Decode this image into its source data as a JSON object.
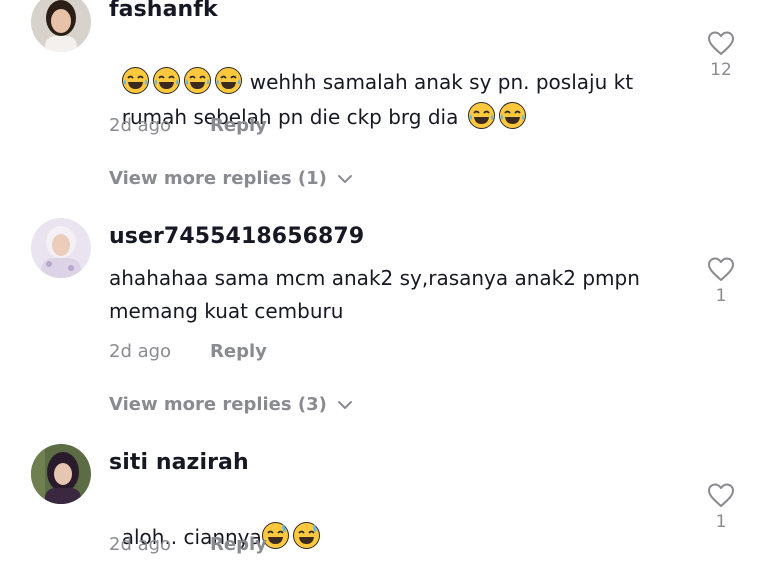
{
  "comments": [
    {
      "username": "fashanfk",
      "text_line1_suffix": "wehhh samalah anak sy pn. poslaju kt",
      "text_line2": "rumah sebelah pn die ckp brg dia",
      "time": "2d ago",
      "reply_label": "Reply",
      "likes": "12",
      "more_replies": "View more replies (1)"
    },
    {
      "username": "user7455418656879",
      "text_line1": "ahahahaa sama mcm anak2 sy,rasanya anak2 pmpn",
      "text_line2": "memang kuat cemburu",
      "time": "2d ago",
      "reply_label": "Reply",
      "likes": "1",
      "more_replies": "View more replies (3)"
    },
    {
      "username": "siti nazirah",
      "text_line1": "aloh.. ciannya",
      "time": "2d ago",
      "reply_label": "Reply",
      "likes": "1"
    }
  ],
  "colors": {
    "text": "#161823",
    "muted": "#8a8b91",
    "emoji": "#FFC83D"
  }
}
